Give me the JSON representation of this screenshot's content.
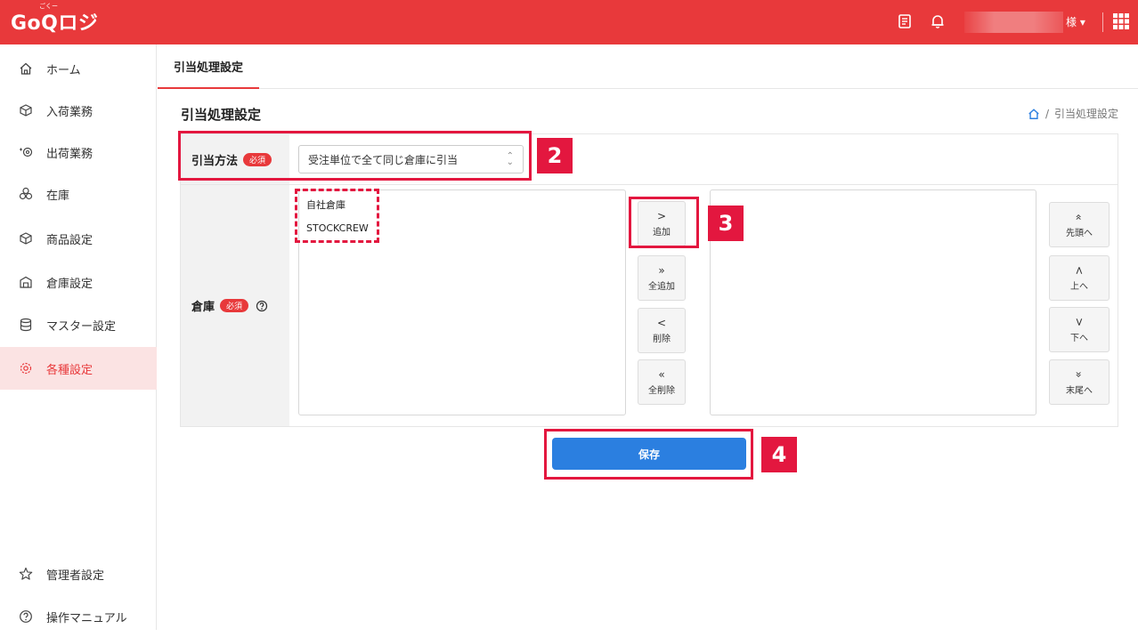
{
  "header": {
    "logo": "GoQロジ",
    "logo_ruby": "ごくー",
    "user_suffix": "様 ▾",
    "icons": [
      "book-icon",
      "bell-icon",
      "apps-grid-icon"
    ],
    "color": "#e8393b"
  },
  "sidebar": {
    "items": [
      {
        "label": "ホーム",
        "icon": "home-icon"
      },
      {
        "label": "入荷業務",
        "icon": "inbound-box-icon"
      },
      {
        "label": "出荷業務",
        "icon": "outbound-icon"
      },
      {
        "label": "在庫",
        "icon": "boxes-icon"
      },
      {
        "label": "商品設定",
        "icon": "product-box-icon"
      },
      {
        "label": "倉庫設定",
        "icon": "warehouse-icon"
      },
      {
        "label": "マスター設定",
        "icon": "database-icon"
      },
      {
        "label": "各種設定",
        "icon": "gear-icon",
        "active": true
      }
    ],
    "bottom_items": [
      {
        "label": "管理者設定",
        "icon": "star-icon"
      },
      {
        "label": "操作マニュアル",
        "icon": "help-circle-icon"
      }
    ]
  },
  "tab": {
    "label": "引当処理設定"
  },
  "page": {
    "title": "引当処理設定",
    "breadcrumb_current": "引当処理設定"
  },
  "form": {
    "method_label": "引当方法",
    "required_badge": "必須",
    "method_value": "受注単位で全て同じ倉庫に引当",
    "warehouse_label": "倉庫",
    "available_warehouses": [
      "自社倉庫",
      "STOCKCREW"
    ],
    "selected_warehouses": [],
    "move_buttons": [
      {
        "arrow": ">",
        "label": "追加"
      },
      {
        "arrow": "»",
        "label": "全追加"
      },
      {
        "arrow": "<",
        "label": "削除"
      },
      {
        "arrow": "«",
        "label": "全削除"
      }
    ],
    "order_buttons": [
      {
        "arrow": "«",
        "label": "先頭へ"
      },
      {
        "arrow": "<",
        "label": "上へ"
      },
      {
        "arrow": ">",
        "label": "下へ"
      },
      {
        "arrow": "»",
        "label": "末尾へ"
      }
    ],
    "save_label": "保存"
  },
  "annotations": {
    "step2": "2",
    "step3": "3",
    "step4": "4",
    "color": "#e3173f"
  }
}
